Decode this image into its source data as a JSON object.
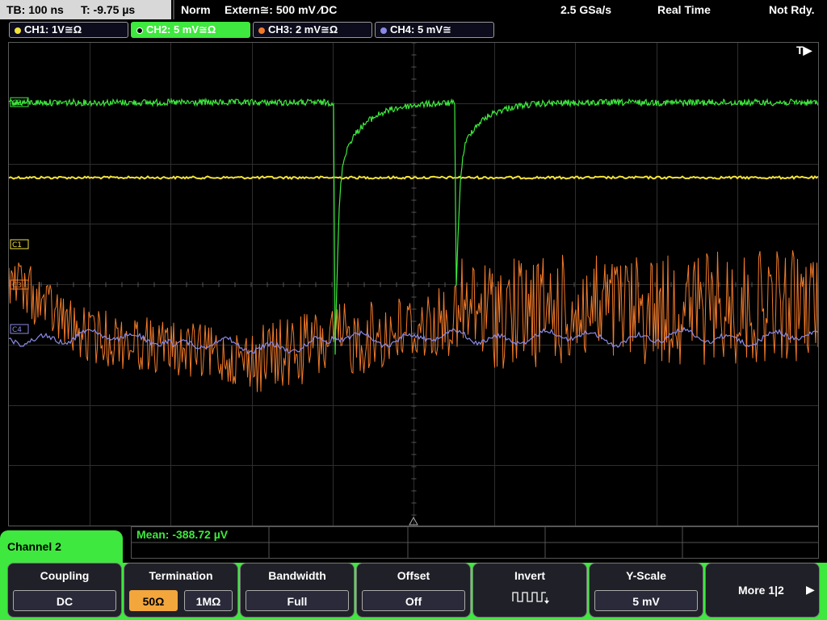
{
  "topbar": {
    "timebase": "TB: 100 ns",
    "trigger_time": "T: -9.75 µs",
    "trigger_mode": "Norm",
    "trigger_source": "Extern≅: 500 mV ⁄DC",
    "sample_rate": "2.5 GSa/s",
    "acq_mode": "Real Time",
    "status": "Not Rdy."
  },
  "channels": [
    {
      "label": "CH1: 1V≅Ω",
      "color": "#f2e23a",
      "active": false
    },
    {
      "label": "CH2: 5 mV≅Ω",
      "color": "#3ee83e",
      "active": true
    },
    {
      "label": "CH3: 2 mV≅Ω",
      "color": "#f07a2a",
      "active": false
    },
    {
      "label": "CH4: 5 mV≅",
      "color": "#8a8ae6",
      "active": false
    }
  ],
  "markers": {
    "ch1": "C1",
    "ch2": "C2",
    "ch3": "C3",
    "ch4": "C4",
    "trigger": "T▶"
  },
  "measurement": {
    "text": "Mean: -388.72 µV"
  },
  "menu": {
    "title": "Channel 2",
    "coupling": {
      "title": "Coupling",
      "value": "DC"
    },
    "termination": {
      "title": "Termination",
      "option_a": "50Ω",
      "option_b": "1MΩ"
    },
    "bandwidth": {
      "title": "Bandwidth",
      "value": "Full"
    },
    "offset": {
      "title": "Offset",
      "value": "Off"
    },
    "invert": {
      "title": "Invert"
    },
    "yscale": {
      "title": "Y-Scale",
      "value": "5 mV"
    },
    "more": {
      "label": "More 1|2",
      "arrow": "▶"
    }
  },
  "colors": {
    "ch1": "#f2e23a",
    "ch2": "#3ee83e",
    "ch3": "#f07a2a",
    "ch4": "#8a8ae6",
    "menu_accent": "#3ee83e",
    "selected": "#f2a63c"
  }
}
